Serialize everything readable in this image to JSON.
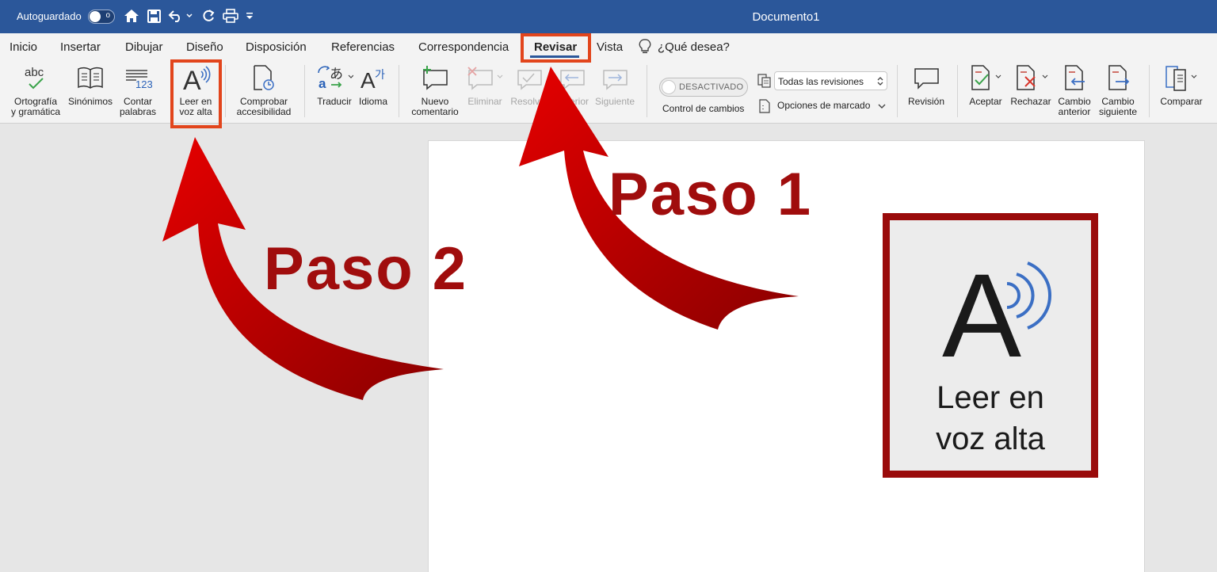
{
  "titlebar": {
    "autosave_label": "Autoguardado",
    "toggle_state": "o",
    "doc_title": "Documento1"
  },
  "tabs": [
    {
      "label": "Inicio"
    },
    {
      "label": "Insertar"
    },
    {
      "label": "Dibujar"
    },
    {
      "label": "Diseño"
    },
    {
      "label": "Disposición"
    },
    {
      "label": "Referencias"
    },
    {
      "label": "Correspondencia"
    },
    {
      "label": "Revisar",
      "active": true
    },
    {
      "label": "Vista"
    },
    {
      "label": "¿Qué desea?"
    }
  ],
  "ribbon": {
    "spelling": {
      "icon_text": "abc",
      "line1": "Ortografía",
      "line2": "y gramática"
    },
    "thesaurus": {
      "line1": "Sinónimos"
    },
    "wordcount": {
      "icon_text": "123",
      "line1": "Contar",
      "line2": "palabras"
    },
    "read_aloud": {
      "icon_text": "A",
      "line1": "Leer en",
      "line2": "voz alta"
    },
    "accessibility": {
      "line1": "Comprobar",
      "line2": "accesibilidad"
    },
    "translate": {
      "line1": "Traducir"
    },
    "language": {
      "icon_text": "A가",
      "line1": "Idioma"
    },
    "new_comment": {
      "line1": "Nuevo",
      "line2": "comentario"
    },
    "delete": {
      "line1": "Eliminar"
    },
    "resolve": {
      "line1": "Resolver"
    },
    "previous": {
      "line1": "Anterior"
    },
    "next": {
      "line1": "Siguiente"
    },
    "track_toggle": "DESACTIVADO",
    "track_changes": "Control de cambios",
    "all_revisions": "Todas las revisiones",
    "markup_options": "Opciones de marcado",
    "revision": {
      "line1": "Revisión"
    },
    "accept": {
      "line1": "Aceptar"
    },
    "reject": {
      "line1": "Rechazar"
    },
    "prev_change": {
      "line1": "Cambio",
      "line2": "anterior"
    },
    "next_change": {
      "line1": "Cambio",
      "line2": "siguiente"
    },
    "compare": {
      "line1": "Comparar"
    }
  },
  "annotations": {
    "step1": "Paso 1",
    "step2": "Paso 2",
    "zoom_letter": "A",
    "zoom_line1": "Leer en",
    "zoom_line2": "voz alta",
    "arrow_color": "#d40000",
    "highlight_color": "#e2451c",
    "callout_border": "#9a0b0b"
  },
  "colors": {
    "brand": "#2b579a"
  }
}
